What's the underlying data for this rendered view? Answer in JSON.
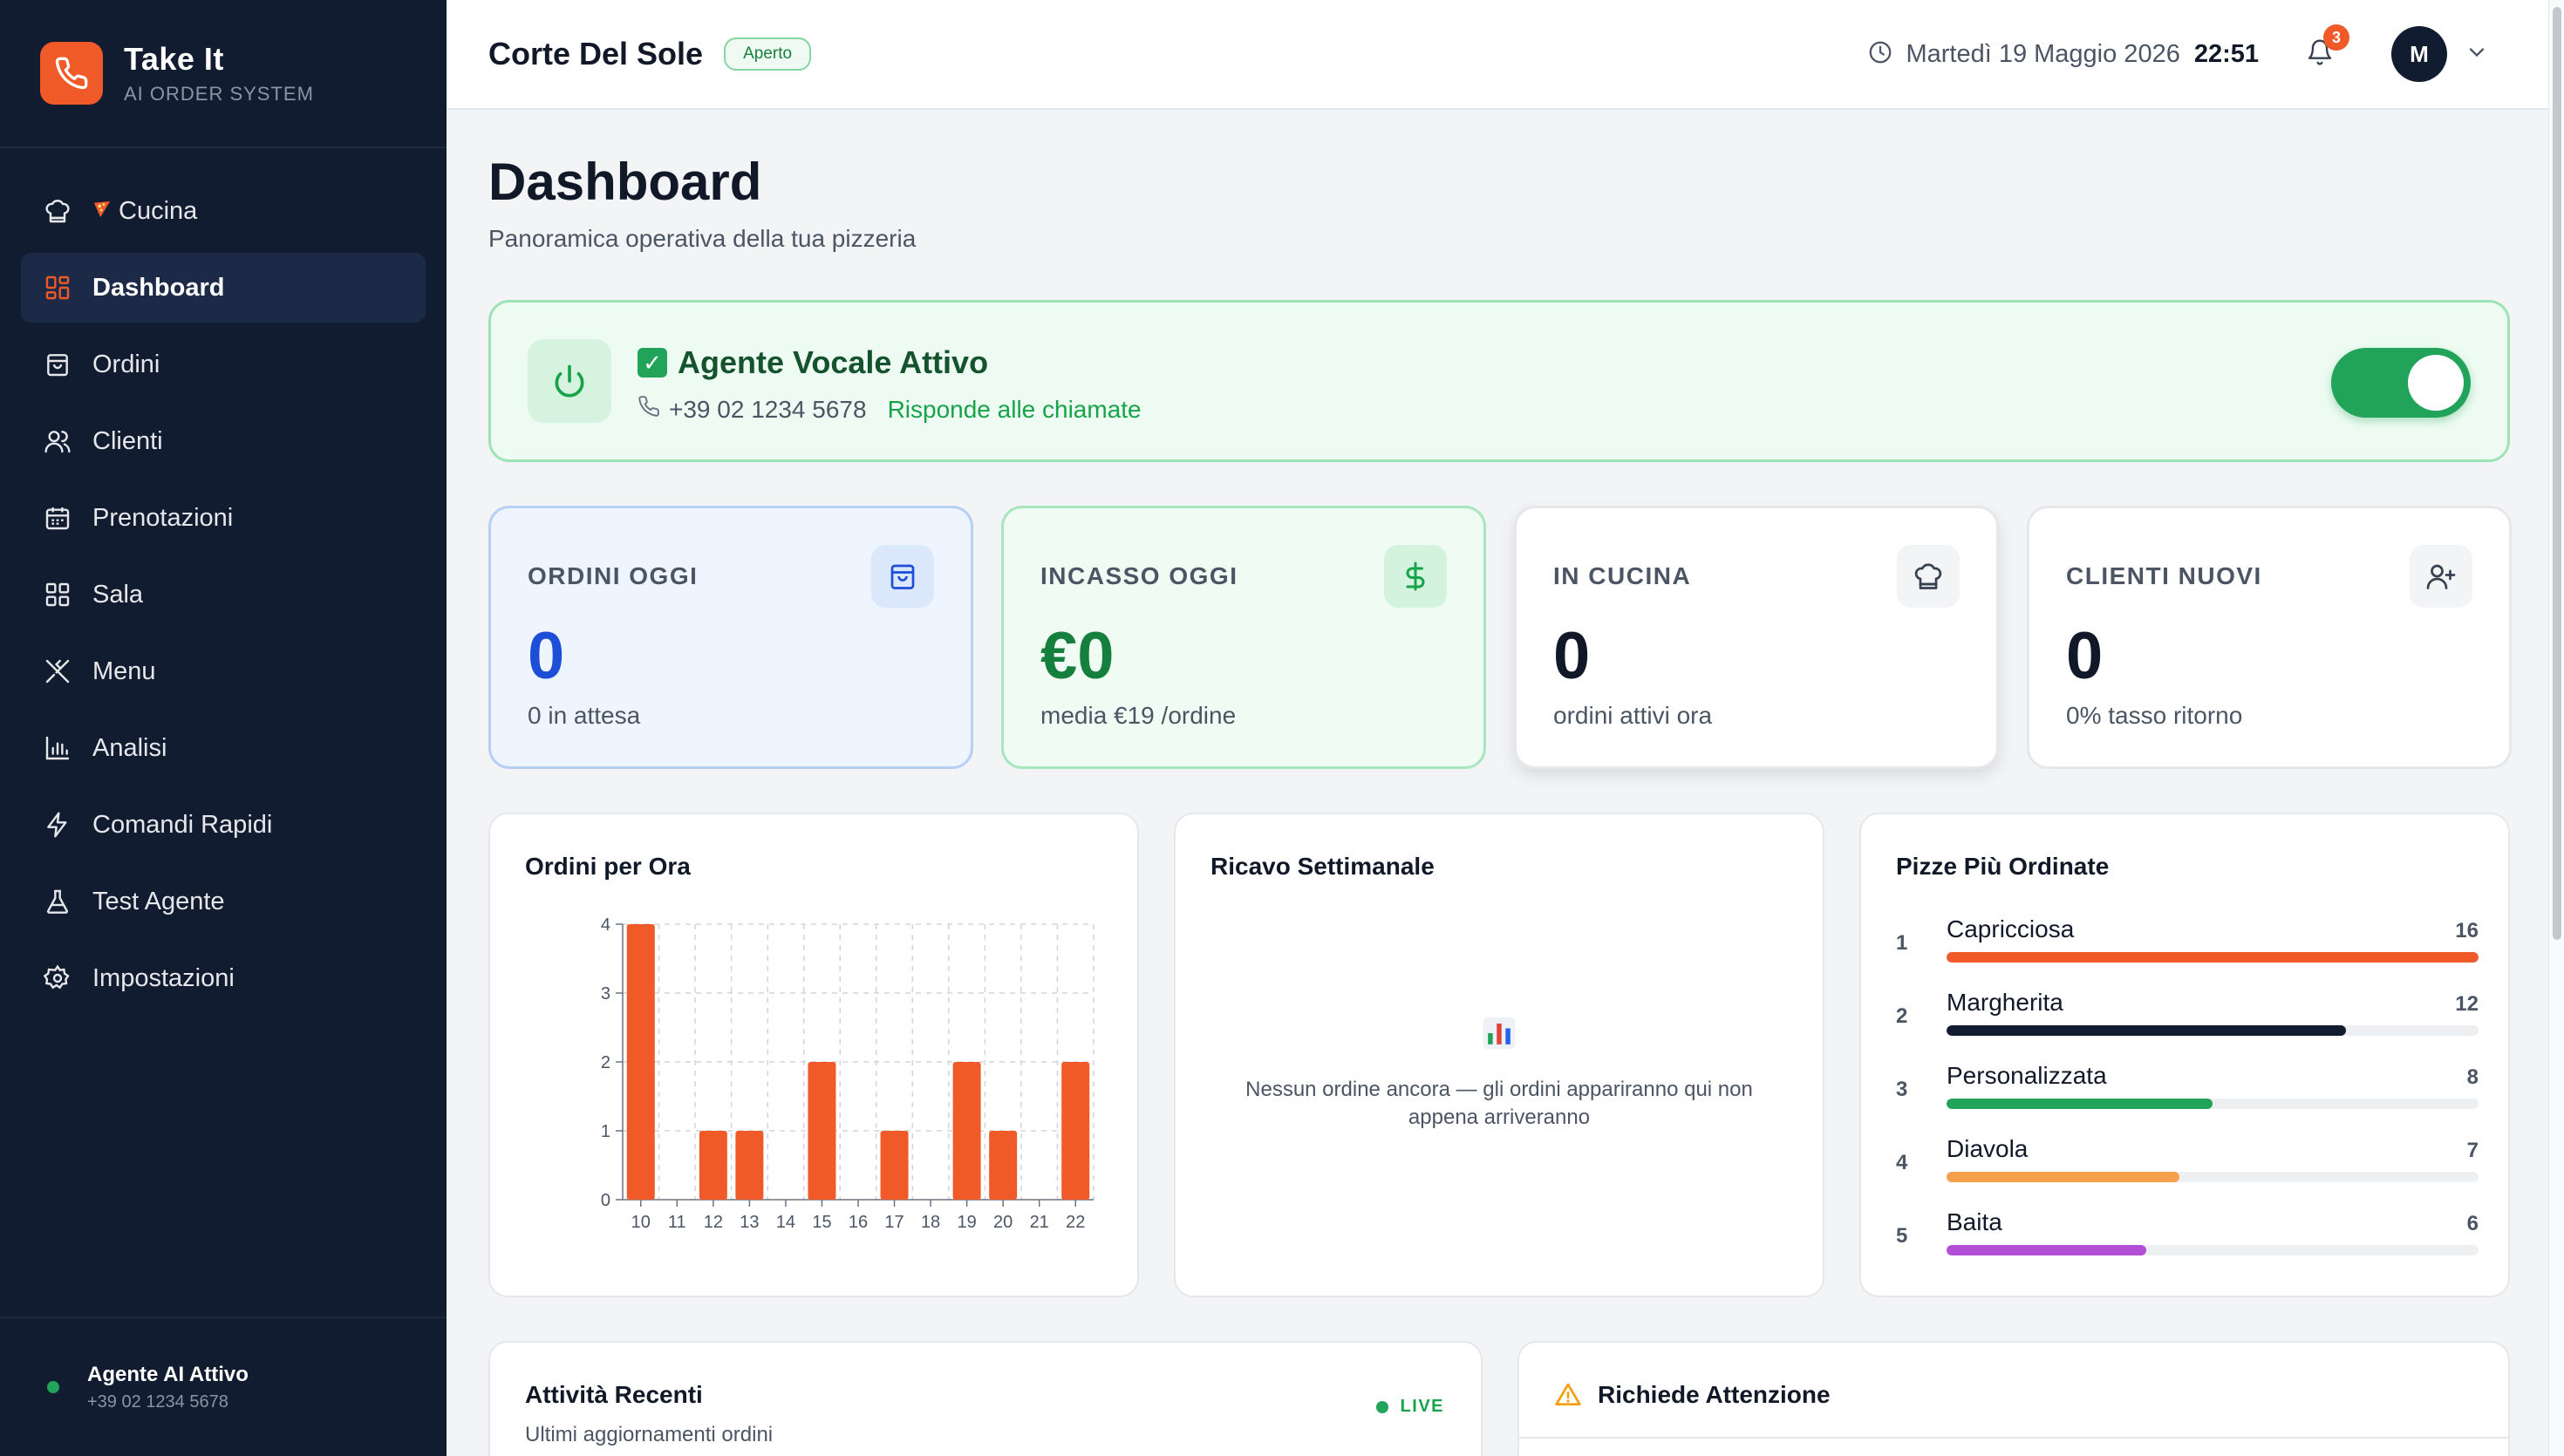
{
  "brand": {
    "name": "Take It",
    "subtitle": "AI ORDER SYSTEM"
  },
  "sidebar": {
    "items": [
      {
        "label": "Cucina",
        "icon": "chef-hat-icon",
        "prefix": "pizza-icon"
      },
      {
        "label": "Dashboard",
        "icon": "dashboard-grid-icon",
        "active": true
      },
      {
        "label": "Ordini",
        "icon": "shopping-bag-icon"
      },
      {
        "label": "Clienti",
        "icon": "users-icon"
      },
      {
        "label": "Prenotazioni",
        "icon": "calendar-icon"
      },
      {
        "label": "Sala",
        "icon": "grid-icon"
      },
      {
        "label": "Menu",
        "icon": "utensils-icon"
      },
      {
        "label": "Analisi",
        "icon": "bar-chart-icon"
      },
      {
        "label": "Comandi Rapidi",
        "icon": "lightning-icon"
      },
      {
        "label": "Test Agente",
        "icon": "flask-icon"
      },
      {
        "label": "Impostazioni",
        "icon": "gear-icon"
      }
    ],
    "footer": {
      "title": "Agente AI Attivo",
      "phone": "+39 02 1234 5678"
    }
  },
  "header": {
    "restaurant": "Corte Del Sole",
    "status": "Aperto",
    "date": "Martedì 19 Maggio 2026",
    "time": "22:51",
    "notifications": "3",
    "avatar": "M"
  },
  "page": {
    "title": "Dashboard",
    "subtitle": "Panoramica operativa della tua pizzeria"
  },
  "agent": {
    "title": "Agente Vocale Attivo",
    "phone": "+39 02 1234 5678",
    "status": "Risponde alle chiamate",
    "enabled": true
  },
  "stats": [
    {
      "label": "ORDINI OGGI",
      "value": "0",
      "sub": "0 in attesa",
      "icon": "shopping-bag-icon"
    },
    {
      "label": "INCASSO OGGI",
      "value": "€0",
      "sub": "media €19 /ordine",
      "icon": "dollar-icon"
    },
    {
      "label": "IN CUCINA",
      "value": "0",
      "sub": "ordini attivi ora",
      "icon": "chef-hat-icon"
    },
    {
      "label": "CLIENTI NUOVI",
      "value": "0",
      "sub": "0% tasso ritorno",
      "icon": "user-plus-icon"
    }
  ],
  "orders_chart": {
    "title": "Ordini per Ora"
  },
  "chart_data": {
    "type": "bar",
    "title": "Ordini per Ora",
    "categories": [
      "10",
      "11",
      "12",
      "13",
      "14",
      "15",
      "16",
      "17",
      "18",
      "19",
      "20",
      "21",
      "22"
    ],
    "values": [
      4,
      0,
      1,
      1,
      0,
      2,
      0,
      1,
      0,
      2,
      1,
      0,
      2
    ],
    "ylim": [
      0,
      4
    ],
    "yticks": [
      "0",
      "1",
      "2",
      "3",
      "4"
    ],
    "color": "#f05a28",
    "grid": true
  },
  "revenue": {
    "title": "Ricavo Settimanale",
    "empty": "Nessun ordine ancora — gli ordini appariranno qui non appena arriveranno",
    "icon": "bar-chart-emoji-icon"
  },
  "top_pizzas": {
    "title": "Pizze Più Ordinate",
    "max": 16,
    "items": [
      {
        "rank": "1",
        "name": "Capricciosa",
        "count": 16,
        "color": "#f05a28"
      },
      {
        "rank": "2",
        "name": "Margherita",
        "count": 12,
        "color": "#121c30"
      },
      {
        "rank": "3",
        "name": "Personalizzata",
        "count": 8,
        "color": "#22a35a"
      },
      {
        "rank": "4",
        "name": "Diavola",
        "count": 7,
        "color": "#f5a04a"
      },
      {
        "rank": "5",
        "name": "Baita",
        "count": 6,
        "color": "#b24fd6"
      }
    ]
  },
  "activity": {
    "title": "Attività Recenti",
    "subtitle": "Ultimi aggiornamenti ordini",
    "live": "LIVE"
  },
  "attention": {
    "title": "Richiede Attenzione",
    "icon": "warning-icon"
  }
}
